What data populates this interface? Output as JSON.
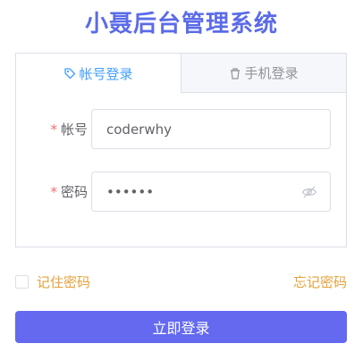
{
  "header": {
    "title": "小聂后台管理系统"
  },
  "tabs": [
    {
      "label": "帐号登录",
      "icon": "tag-icon",
      "active": true
    },
    {
      "label": "手机登录",
      "icon": "phone-icon",
      "active": false
    }
  ],
  "form": {
    "required_mark": "*",
    "account_label": "帐号",
    "account_value": "coderwhy",
    "password_label": "密码",
    "password_value": "123456",
    "password_toggle_icon": "eye-hidden-icon"
  },
  "options": {
    "remember_label": "记住密码",
    "remember_checked": false,
    "forgot_label": "忘记密码"
  },
  "actions": {
    "login_label": "立即登录"
  },
  "colors": {
    "brand": "#5b6be8",
    "tab_active": "#409eff",
    "required": "#f56c6c",
    "warning_link": "#e6a23c",
    "button": "#6469f0"
  }
}
